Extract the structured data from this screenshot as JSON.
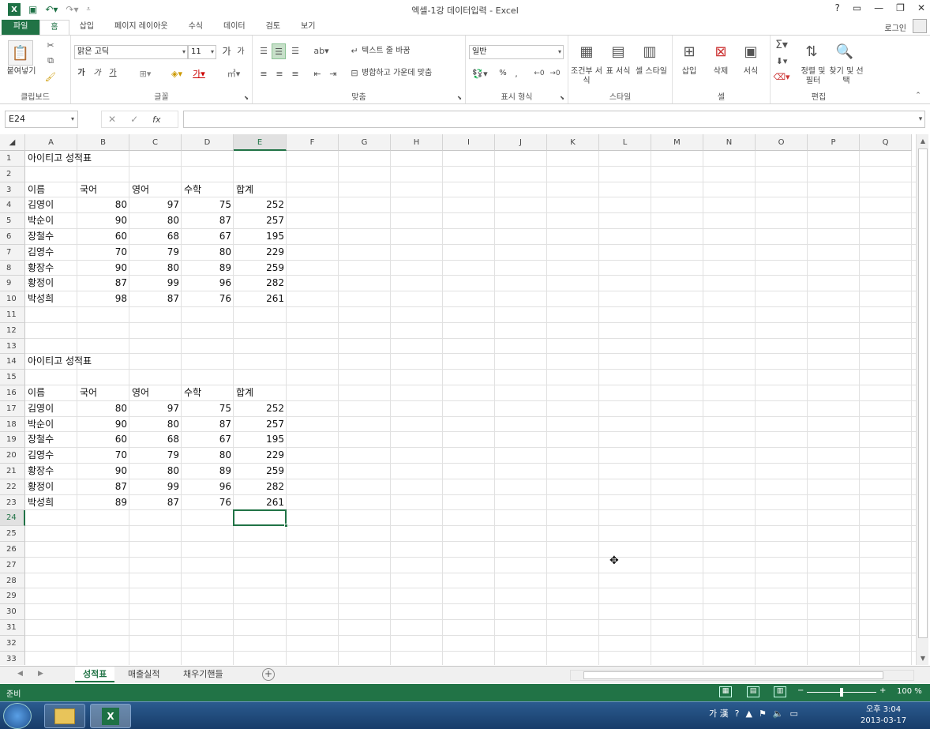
{
  "window": {
    "title": "엑셀-1강 데이터입력 - Excel",
    "help": "?",
    "min": "—",
    "restore": "❐",
    "close": "✕"
  },
  "tabs": [
    "파일",
    "홈",
    "삽입",
    "페이지 레이아웃",
    "수식",
    "데이터",
    "검토",
    "보기"
  ],
  "active_tab": "홈",
  "login": "로그인",
  "ribbon": {
    "clipboard": {
      "paste": "붙여넣기",
      "label": "클립보드"
    },
    "font": {
      "family": "맑은 고딕",
      "size": "11",
      "label": "글꼴",
      "bold": "가",
      "italic": "가",
      "underline": "가",
      "grow": "가",
      "shrink": "가"
    },
    "align": {
      "wrap": "텍스트 줄 바꿈",
      "merge": "병합하고 가운데 맞춤",
      "label": "맞춤"
    },
    "number": {
      "format": "일반",
      "label": "표시 형식",
      "percent": "%"
    },
    "styles": {
      "cond": "조건부 서식",
      "table": "표 서식",
      "cell": "셀 스타일",
      "label": "스타일"
    },
    "cells": {
      "insert": "삽입",
      "delete": "삭제",
      "format": "서식",
      "label": "셀"
    },
    "edit": {
      "sort": "정렬 및 필터",
      "find": "찾기 및 선택",
      "label": "편집"
    }
  },
  "formula_bar": {
    "name_box": "E24",
    "value": "",
    "fx": "fx"
  },
  "columns": [
    "A",
    "B",
    "C",
    "D",
    "E",
    "F",
    "G",
    "H",
    "I",
    "J",
    "K",
    "L",
    "M",
    "N",
    "O",
    "P",
    "Q"
  ],
  "rows_visible": 33,
  "selected_cell": "E24",
  "sheet": [
    {
      "row": 1,
      "A": "아이티고 성적표"
    },
    {
      "row": 3,
      "A": "이름",
      "B": "국어",
      "C": "영어",
      "D": "수학",
      "E": "합계"
    },
    {
      "row": 4,
      "A": "김영이",
      "B": "80",
      "C": "97",
      "D": "75",
      "E": "252"
    },
    {
      "row": 5,
      "A": "박순이",
      "B": "90",
      "C": "80",
      "D": "87",
      "E": "257"
    },
    {
      "row": 6,
      "A": "장철수",
      "B": "60",
      "C": "68",
      "D": "67",
      "E": "195"
    },
    {
      "row": 7,
      "A": "김영수",
      "B": "70",
      "C": "79",
      "D": "80",
      "E": "229"
    },
    {
      "row": 8,
      "A": "황장수",
      "B": "90",
      "C": "80",
      "D": "89",
      "E": "259"
    },
    {
      "row": 9,
      "A": "황정이",
      "B": "87",
      "C": "99",
      "D": "96",
      "E": "282"
    },
    {
      "row": 10,
      "A": "박성희",
      "B": "98",
      "C": "87",
      "D": "76",
      "E": "261"
    },
    {
      "row": 14,
      "A": "아이티고 성적표"
    },
    {
      "row": 16,
      "A": "이름",
      "B": "국어",
      "C": "영어",
      "D": "수학",
      "E": "합계"
    },
    {
      "row": 17,
      "A": "김영이",
      "B": "80",
      "C": "97",
      "D": "75",
      "E": "252"
    },
    {
      "row": 18,
      "A": "박순이",
      "B": "90",
      "C": "80",
      "D": "87",
      "E": "257"
    },
    {
      "row": 19,
      "A": "장철수",
      "B": "60",
      "C": "68",
      "D": "67",
      "E": "195"
    },
    {
      "row": 20,
      "A": "김영수",
      "B": "70",
      "C": "79",
      "D": "80",
      "E": "229"
    },
    {
      "row": 21,
      "A": "황장수",
      "B": "90",
      "C": "80",
      "D": "89",
      "E": "259"
    },
    {
      "row": 22,
      "A": "황정이",
      "B": "87",
      "C": "99",
      "D": "96",
      "E": "282"
    },
    {
      "row": 23,
      "A": "박성희",
      "B": "89",
      "C": "87",
      "D": "76",
      "E": "261"
    }
  ],
  "sheet_tabs": [
    "성적표",
    "매출실적",
    "채우기핸들"
  ],
  "active_sheet": "성적표",
  "status": {
    "ready": "준비",
    "zoom": "100 %"
  },
  "taskbar": {
    "ime": "가 漢",
    "time": "오후 3:04",
    "date": "2013-03-17"
  },
  "colors": {
    "accent": "#217346"
  }
}
